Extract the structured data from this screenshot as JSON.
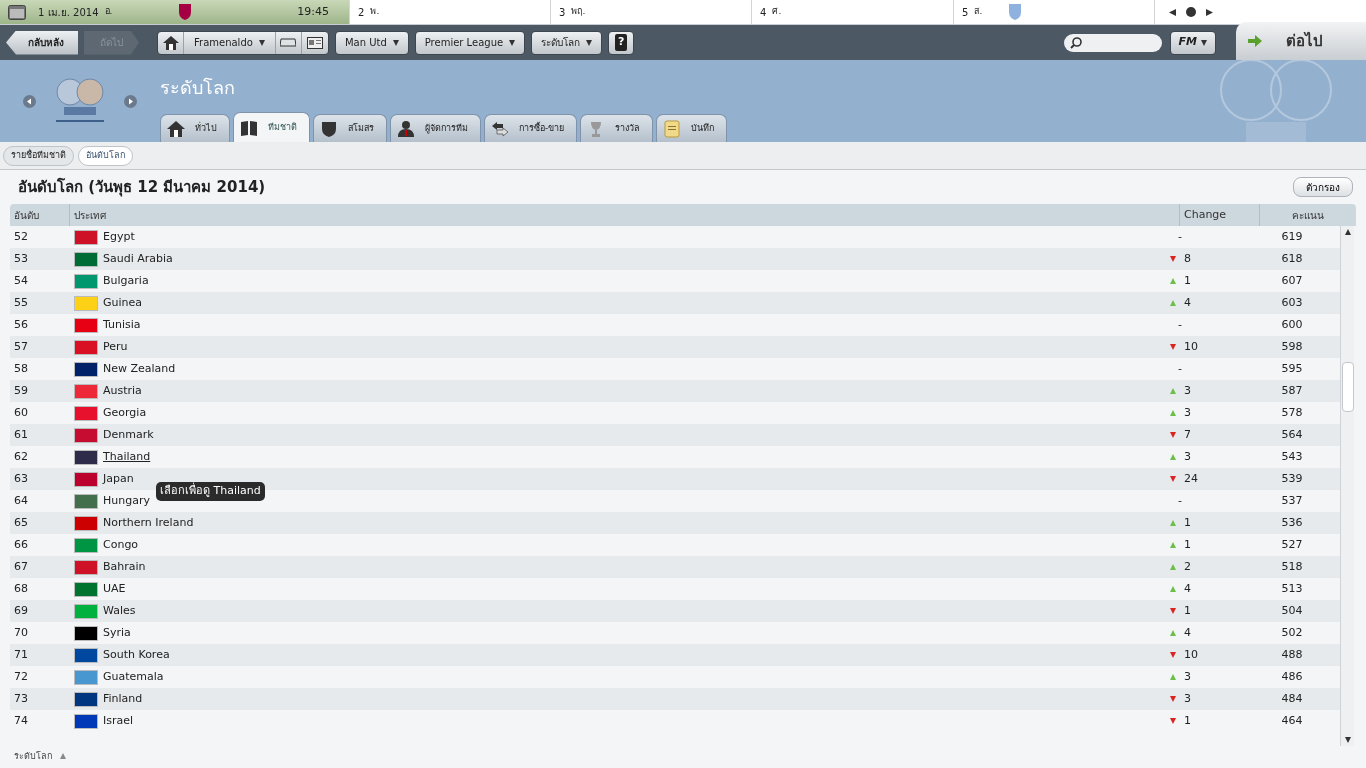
{
  "calendar": {
    "days": [
      {
        "label": "1 เม.ย. 2014",
        "weekday": "อ.",
        "time": "19:45",
        "selected": true,
        "color": "#a50044"
      },
      {
        "label": "2",
        "weekday": "พ.",
        "selected": false
      },
      {
        "label": "3",
        "weekday": "พฤ.",
        "selected": false
      },
      {
        "label": "4",
        "weekday": "ศ.",
        "selected": false
      },
      {
        "label": "5",
        "weekday": "ส.",
        "selected": false,
        "color": "#8fb1e0"
      }
    ],
    "continue_label": "ต่อไป"
  },
  "toolbar": {
    "back": "กลับหลัง",
    "forward": "ถัดไป",
    "forward_disabled": true,
    "menus": [
      "Framenaldo",
      "Man Utd",
      "Premier League",
      "ระดับโลก"
    ],
    "help": "?",
    "fm": "FM"
  },
  "header": {
    "title": "ระดับโลก",
    "tabs": [
      {
        "label": "ทั่วไป",
        "selected": false
      },
      {
        "label": "ทีมชาติ",
        "selected": true
      },
      {
        "label": "สโมสร",
        "selected": false
      },
      {
        "label": "ผู้จัดการทีม",
        "selected": false
      },
      {
        "label": "การซื้อ-ขาย",
        "selected": false
      },
      {
        "label": "รางวัล",
        "selected": false
      },
      {
        "label": "บันทึก",
        "selected": false
      }
    ]
  },
  "subtabs": [
    {
      "label": "รายชื่อทีมชาติ",
      "selected": false
    },
    {
      "label": "อันดับโลก",
      "selected": true
    }
  ],
  "page_title": "อันดับโลก (วันพุธ 12 มีนาคม 2014)",
  "filter_button": "ตัวกรอง",
  "table": {
    "columns": [
      "อันดับ",
      "ประเทศ",
      "Change",
      "คะแนน"
    ],
    "rows": [
      {
        "rank": "52",
        "country": "Egypt",
        "color": "#ce1126",
        "kind": "none",
        "change": "-",
        "points": "619",
        "hovered": false
      },
      {
        "rank": "53",
        "country": "Saudi Arabia",
        "color": "#006c35",
        "kind": "down",
        "change": "8",
        "points": "618",
        "hovered": false
      },
      {
        "rank": "54",
        "country": "Bulgaria",
        "color": "#00966e",
        "kind": "up",
        "change": "1",
        "points": "607",
        "hovered": false
      },
      {
        "rank": "55",
        "country": "Guinea",
        "color": "#fcd116",
        "kind": "up",
        "change": "4",
        "points": "603",
        "hovered": false
      },
      {
        "rank": "56",
        "country": "Tunisia",
        "color": "#e70013",
        "kind": "none",
        "change": "-",
        "points": "600",
        "hovered": false
      },
      {
        "rank": "57",
        "country": "Peru",
        "color": "#d91023",
        "kind": "down",
        "change": "10",
        "points": "598",
        "hovered": false
      },
      {
        "rank": "58",
        "country": "New Zealand",
        "color": "#012169",
        "kind": "none",
        "change": "-",
        "points": "595",
        "hovered": false
      },
      {
        "rank": "59",
        "country": "Austria",
        "color": "#ed2939",
        "kind": "up",
        "change": "3",
        "points": "587",
        "hovered": false
      },
      {
        "rank": "60",
        "country": "Georgia",
        "color": "#e8112d",
        "kind": "up",
        "change": "3",
        "points": "578",
        "hovered": false
      },
      {
        "rank": "61",
        "country": "Denmark",
        "color": "#c60c30",
        "kind": "down",
        "change": "7",
        "points": "564",
        "hovered": false
      },
      {
        "rank": "62",
        "country": "Thailand",
        "color": "#2d2a4a",
        "kind": "up",
        "change": "3",
        "points": "543",
        "hovered": true
      },
      {
        "rank": "63",
        "country": "Japan",
        "color": "#bc002d",
        "kind": "down",
        "change": "24",
        "points": "539",
        "hovered": false
      },
      {
        "rank": "64",
        "country": "Hungary",
        "color": "#436f4d",
        "kind": "none",
        "change": "-",
        "points": "537",
        "hovered": false
      },
      {
        "rank": "65",
        "country": "Northern Ireland",
        "color": "#cc0000",
        "kind": "up",
        "change": "1",
        "points": "536",
        "hovered": false
      },
      {
        "rank": "66",
        "country": "Congo",
        "color": "#009543",
        "kind": "up",
        "change": "1",
        "points": "527",
        "hovered": false
      },
      {
        "rank": "67",
        "country": "Bahrain",
        "color": "#ce1126",
        "kind": "up",
        "change": "2",
        "points": "518",
        "hovered": false
      },
      {
        "rank": "68",
        "country": "UAE",
        "color": "#00732f",
        "kind": "up",
        "change": "4",
        "points": "513",
        "hovered": false
      },
      {
        "rank": "69",
        "country": "Wales",
        "color": "#00b140",
        "kind": "down",
        "change": "1",
        "points": "504",
        "hovered": false
      },
      {
        "rank": "70",
        "country": "Syria",
        "color": "#000000",
        "kind": "up",
        "change": "4",
        "points": "502",
        "hovered": false
      },
      {
        "rank": "71",
        "country": "South Korea",
        "color": "#0047a0",
        "kind": "down",
        "change": "10",
        "points": "488",
        "hovered": false
      },
      {
        "rank": "72",
        "country": "Guatemala",
        "color": "#4997d0",
        "kind": "up",
        "change": "3",
        "points": "486",
        "hovered": false
      },
      {
        "rank": "73",
        "country": "Finland",
        "color": "#003580",
        "kind": "down",
        "change": "3",
        "points": "484",
        "hovered": false
      },
      {
        "rank": "74",
        "country": "Israel",
        "color": "#0038b8",
        "kind": "down",
        "change": "1",
        "points": "464",
        "hovered": false
      }
    ]
  },
  "tooltip": "เลือกเพื่อดู Thailand",
  "footer": "ระดับโลก"
}
